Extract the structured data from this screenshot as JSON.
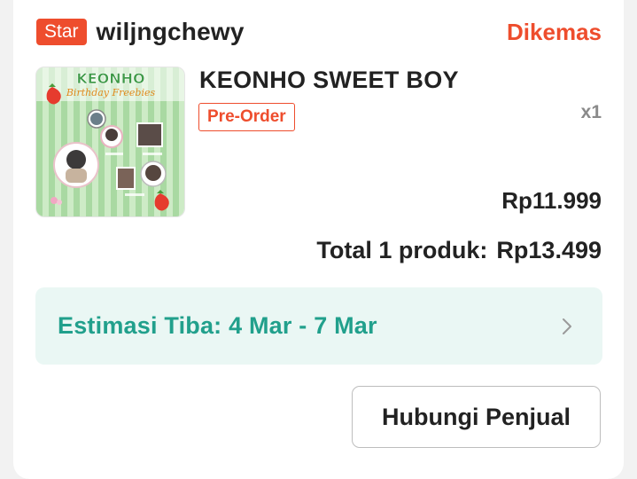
{
  "shop": {
    "badge": "Star",
    "name": "wiljngchewy",
    "status": "Dikemas"
  },
  "product": {
    "title": "KEONHO SWEET BOY",
    "tag": "Pre-Order",
    "quantity": "x1",
    "price": "Rp11.999",
    "thumbnail_text": {
      "title": "KEONHO",
      "subtitle": "Birthday Freebies"
    }
  },
  "order_total": {
    "label": "Total 1 produk:",
    "amount": "Rp13.499"
  },
  "estimate": {
    "label": "Estimasi Tiba: 4 Mar - 7 Mar"
  },
  "actions": {
    "contact_seller": "Hubungi Penjual"
  },
  "colors": {
    "accent": "#ee4d2d",
    "estimate_text": "#21a08c",
    "estimate_bg": "#eaf7f4",
    "thumbnail_green": "#a8d8a3"
  },
  "icons": {
    "chevron": "chevron-right-icon"
  }
}
